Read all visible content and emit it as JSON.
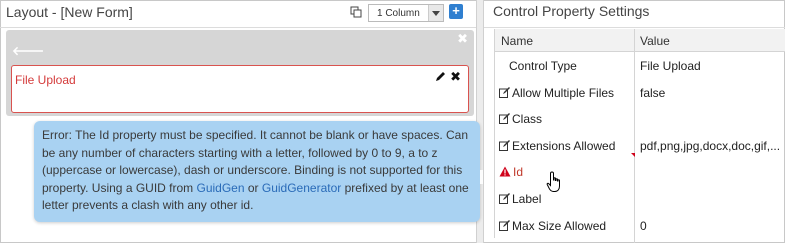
{
  "layout_panel": {
    "title": "Layout - [New Form]",
    "column_select": {
      "value": "1 Column"
    },
    "add_button_label": "+",
    "section": {
      "close_label": "✖",
      "back_label": "🡐"
    },
    "control": {
      "label": "File Upload",
      "delete_label": "✖"
    }
  },
  "tooltip": {
    "text_before": "Error: The Id property must be specified. It cannot be blank or have spaces. Can be any number of characters starting with a letter, followed by 0 to 9, a to z (uppercase or lowercase), dash or underscore. Binding is not supported for this property. Using a GUID from ",
    "link1": "GuidGen",
    "text_middle": " or ",
    "link2": "GuidGenerator",
    "text_after": " prefixed by at least one letter prevents a clash with any other id."
  },
  "properties_panel": {
    "title": "Control Property Settings",
    "headers": {
      "name": "Name",
      "value": "Value"
    },
    "rows": [
      {
        "name": "Control Type",
        "value": "File Upload",
        "icon": "none"
      },
      {
        "name": "Allow Multiple Files",
        "value": "false",
        "icon": "edit-icon"
      },
      {
        "name": "Class",
        "value": "",
        "icon": "edit-icon"
      },
      {
        "name": "Extensions Allowed",
        "value": "pdf,png,jpg,docx,doc,gif,...",
        "icon": "edit-icon"
      },
      {
        "name": "Id",
        "value": "",
        "icon": "warning-icon"
      },
      {
        "name": "Label",
        "value": "",
        "icon": "edit-icon"
      },
      {
        "name": "Max Size Allowed",
        "value": "0",
        "icon": "edit-icon"
      }
    ]
  },
  "colors": {
    "accent": "#2f7fd0",
    "error": "#d43b3b",
    "tooltip_bg": "#a9d2f2",
    "link": "#2a6bb8"
  }
}
